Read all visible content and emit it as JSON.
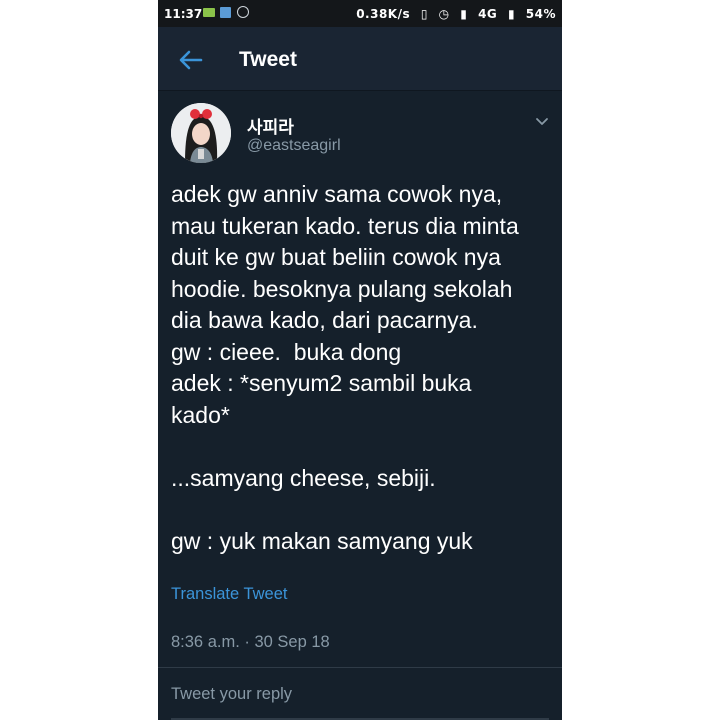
{
  "status_bar": {
    "time": "11:37",
    "speed": "0.38K/s",
    "network": "4G",
    "battery": "54%"
  },
  "header": {
    "title": "Tweet",
    "back_icon": "arrow-left-icon",
    "accent_color": "#3b94d9"
  },
  "tweet": {
    "display_name": "사피라",
    "handle": "@eastseagirl",
    "text": "adek gw anniv sama cowok nya,\nmau tukeran kado. terus dia minta\nduit ke gw buat beliin cowok nya\nhoodie. besoknya pulang sekolah\ndia bawa kado, dari pacarnya.\ngw : cieee.  buka dong\nadek : *senyum2 sambil buka\nkado*\n\n...samyang cheese, sebiji.\n\ngw : yuk makan samyang yuk",
    "translate_label": "Translate Tweet",
    "timestamp": "8:36 a.m. · 30 Sep 18"
  },
  "reply": {
    "placeholder": "Tweet your reply"
  },
  "colors": {
    "background": "#15202b",
    "header": "#1a2533",
    "secondary_text": "#8899a6"
  }
}
